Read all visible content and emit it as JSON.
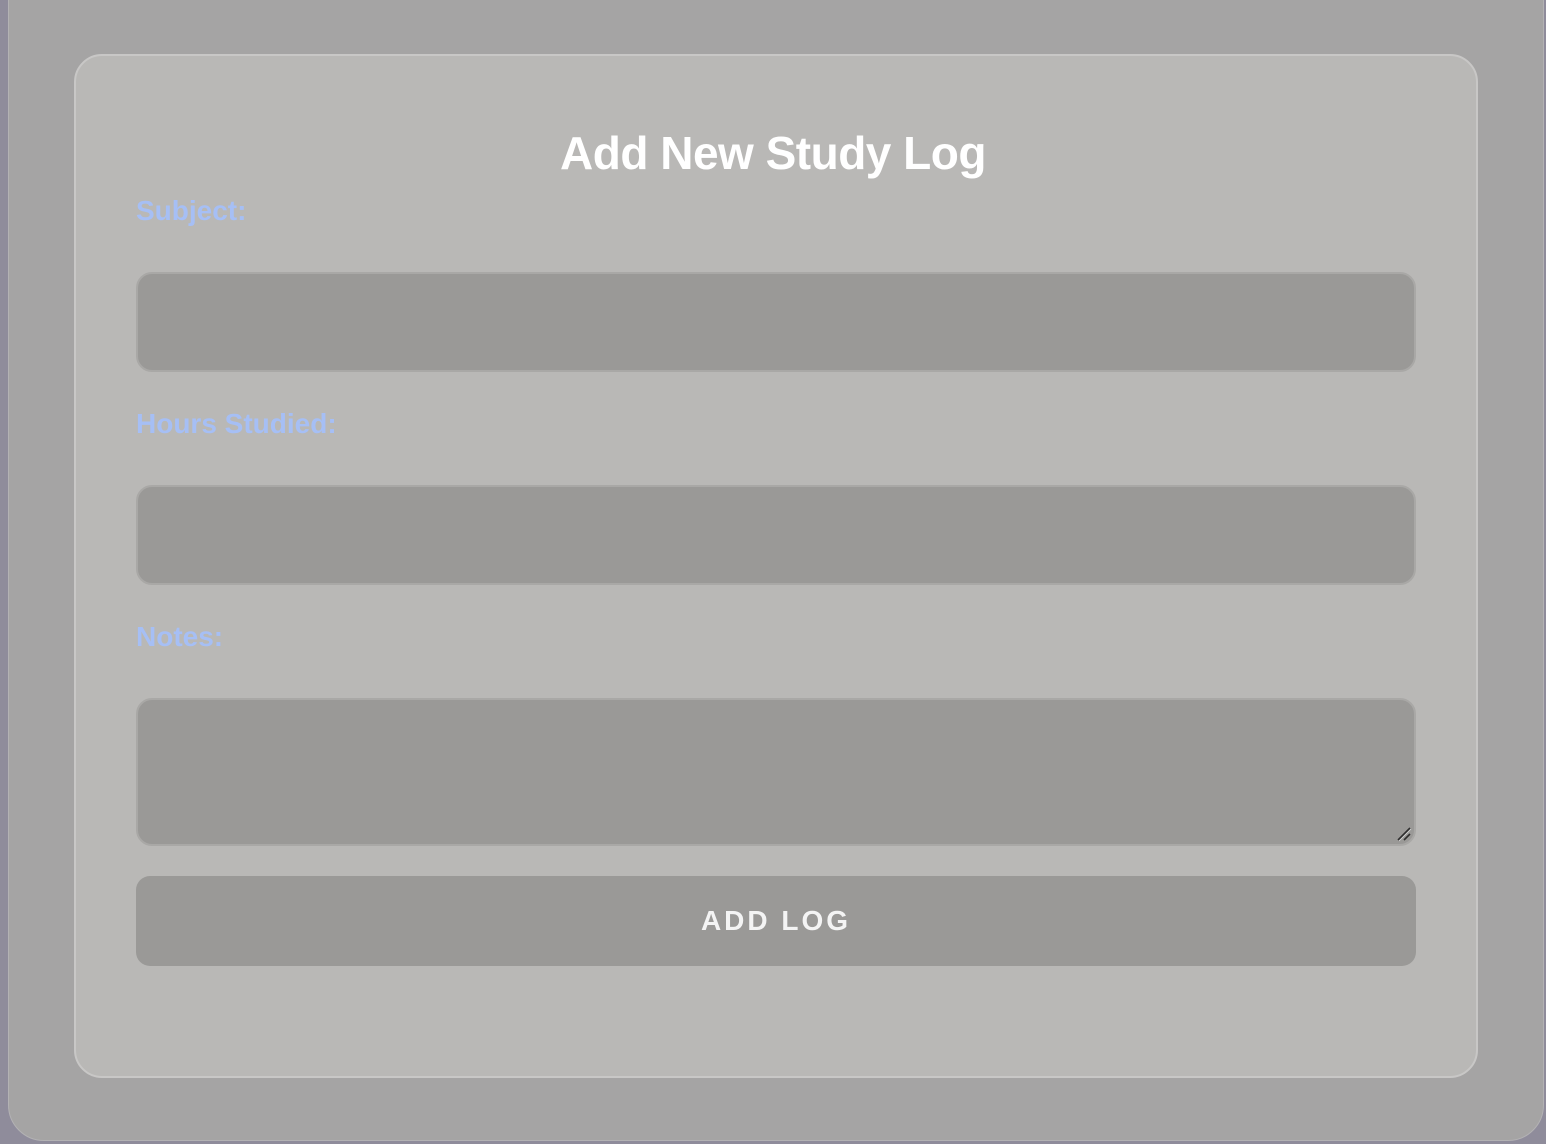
{
  "form": {
    "title": "Add New Study Log",
    "fields": [
      {
        "label": "Subject:",
        "value": "",
        "placeholder": ""
      },
      {
        "label": "Hours Studied:",
        "value": "",
        "placeholder": ""
      },
      {
        "label": "Notes:",
        "value": "",
        "placeholder": ""
      }
    ],
    "submit_label": "ADD LOG"
  },
  "colors": {
    "page_background": "#a5a4a4",
    "card_background": "#b9b8b6",
    "input_background": "#9a9997",
    "label_color": "#a6bff5",
    "title_color": "#ffffff"
  }
}
